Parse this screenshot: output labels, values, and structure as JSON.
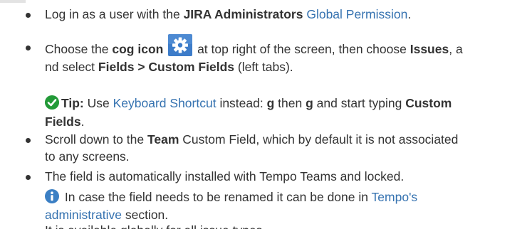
{
  "items": [
    {
      "bullet": true,
      "lines": [
        {
          "parts": [
            {
              "t": "Log in as a user with the "
            },
            {
              "b": "JIRA Administrators"
            },
            {
              "t": " "
            },
            {
              "link": "Global Permission"
            },
            {
              "t": "."
            }
          ]
        }
      ]
    }
  ],
  "item1": {
    "text_a": "Log in as a user with the ",
    "bold_a": "JIRA Administrators",
    "link_a": "Global Permission",
    "end": "."
  },
  "item2": {
    "text_a": "Choose the ",
    "bold_a": "cog icon",
    "text_b": " at top right of the screen, then choose ",
    "bold_b": "Issues",
    "text_c": ", a",
    "text_d": "nd select ",
    "bold_c": "Fields > Custom Fields",
    "text_e": " (left tabs).",
    "icon": "cog-icon",
    "tip": {
      "icon": "tip-check-icon",
      "label": "Tip:",
      "text_a": " Use ",
      "link": "Keyboard Shortcut",
      "text_b": " instead: ",
      "key1": "g",
      "text_c": " then ",
      "key2": "g",
      "text_d": " and start typing ",
      "bold_a": "Custom",
      "bold_b": "Fields",
      "end": "."
    }
  },
  "item3": {
    "text_a": "Scroll down to the ",
    "bold_a": "Team",
    "text_b": " Custom Field, which by default it is not associated",
    "text_c": "to any screens."
  },
  "item4": {
    "text_a": "The field is automatically installed with Tempo Teams and locked.",
    "info": {
      "icon": "info-icon",
      "text_a": " In case the field needs to be renamed it can be done in ",
      "link_a": "Tempo's",
      "link_b": "administrative",
      "text_b": " section."
    }
  },
  "item5": {
    "text_a": "It is available globally for all issue types."
  },
  "colors": {
    "text": "#333333",
    "link": "#3572b0",
    "cog_bg": "#3d7cc9",
    "tip_green": "#14892c",
    "info_blue": "#3b7fc4"
  }
}
